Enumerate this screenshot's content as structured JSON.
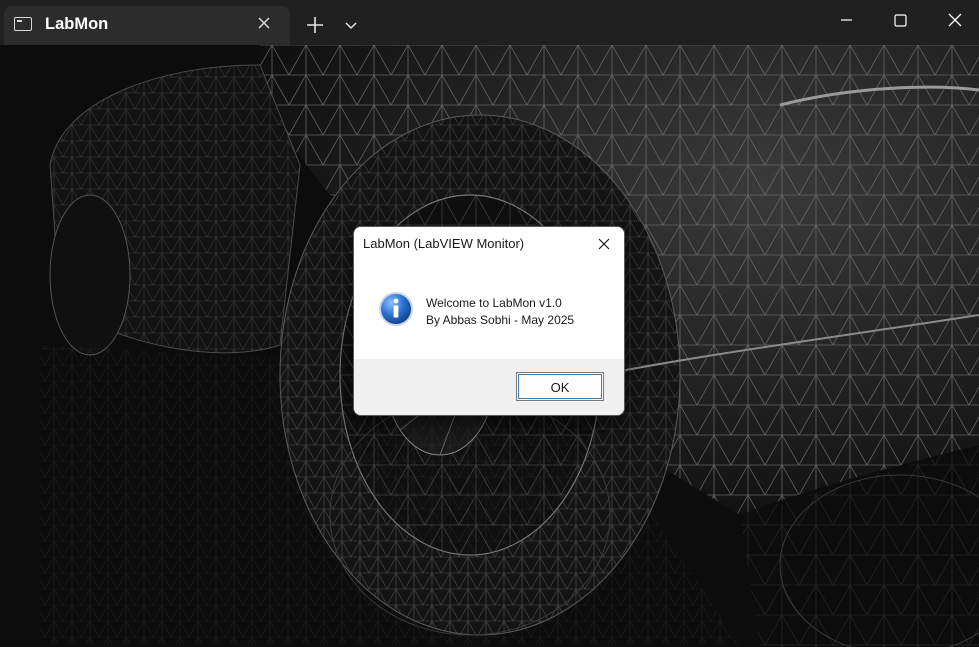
{
  "tab": {
    "title": "LabMon",
    "icon": "terminal-icon"
  },
  "tabbar": {
    "new_tab_icon": "plus-icon",
    "dropdown_icon": "chevron-down-icon"
  },
  "window_controls": {
    "minimize_icon": "minimize-icon",
    "maximize_icon": "maximize-icon",
    "close_icon": "close-icon"
  },
  "dialog": {
    "title": "LabMon (LabVIEW Monitor)",
    "icon": "info-icon",
    "message_line1": "Welcome to LabMon v1.0",
    "message_line2": "By Abbas Sobhi - May 2025",
    "ok_label": "OK"
  },
  "colors": {
    "tabbar_bg": "#202020",
    "active_tab_bg": "#2c2c2c",
    "terminal_bg": "#0c0c0c",
    "dialog_footer_bg": "#f0f0f0",
    "info_blue": "#1f5fb5"
  }
}
